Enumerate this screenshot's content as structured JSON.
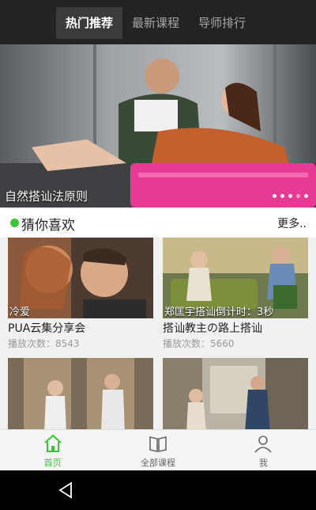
{
  "tabs": [
    {
      "label": "热门推荐"
    },
    {
      "label": "最新课程"
    },
    {
      "label": "导师排行"
    }
  ],
  "banner": {
    "caption": "自然搭讪法原则",
    "dots_total": 5,
    "dot_active": 3
  },
  "section": {
    "title": "猜你喜欢",
    "more": "更多.."
  },
  "cards": [
    {
      "thumb_caption": "冷爱",
      "title": "PUA云集分享会",
      "plays": "播放次数：8543"
    },
    {
      "thumb_caption": "郑匡宇搭讪倒计时：3秒",
      "title": "搭讪教主の路上搭讪",
      "plays": "播放次数：5660"
    },
    {
      "thumb_caption": "",
      "title": "",
      "plays": ""
    },
    {
      "thumb_caption": "",
      "title": "",
      "plays": ""
    }
  ],
  "bottom_nav": [
    {
      "label": "首页",
      "icon": "home-icon"
    },
    {
      "label": "全部课程",
      "icon": "book-icon"
    },
    {
      "label": "我",
      "icon": "user-icon"
    }
  ],
  "colors": {
    "accent": "#3cc43c",
    "topbar": "#232323",
    "banner_pink": "#e63a94"
  }
}
